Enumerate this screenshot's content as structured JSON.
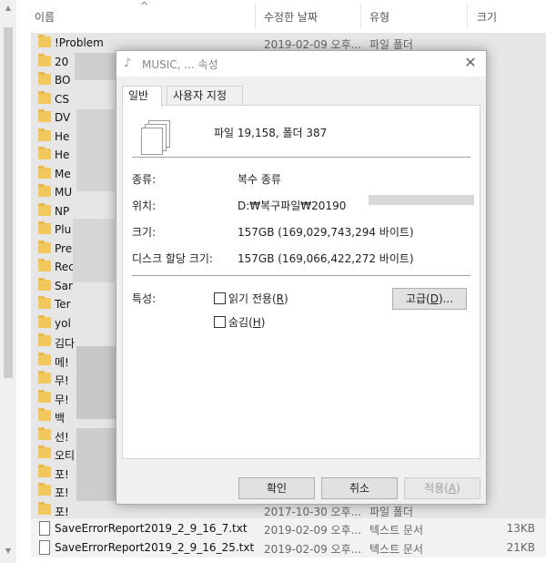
{
  "explorer": {
    "columns": {
      "name": "이름",
      "modified": "수정한 날짜",
      "type": "유형",
      "size": "크기"
    },
    "rows": [
      {
        "name": "!Problem",
        "date": "2019-02-09 오후...",
        "type": "파일 폴더",
        "size": ""
      },
      {
        "name": "20",
        "date": "",
        "type": "",
        "size": ""
      },
      {
        "name": "BO",
        "date": "",
        "type": "",
        "size": ""
      },
      {
        "name": "CS",
        "date": "",
        "type": "",
        "size": ""
      },
      {
        "name": "DV",
        "date": "",
        "type": "",
        "size": ""
      },
      {
        "name": "He",
        "date": "",
        "type": "",
        "size": ""
      },
      {
        "name": "He",
        "date": "",
        "type": "",
        "size": ""
      },
      {
        "name": "Me",
        "date": "",
        "type": "",
        "size": ""
      },
      {
        "name": "MU",
        "date": "",
        "type": "",
        "size": ""
      },
      {
        "name": "NP",
        "date": "",
        "type": "",
        "size": ""
      },
      {
        "name": "Plu",
        "date": "",
        "type": "",
        "size": ""
      },
      {
        "name": "Pre",
        "date": "",
        "type": "",
        "size": ""
      },
      {
        "name": "Rec",
        "date": "",
        "type": "",
        "size": ""
      },
      {
        "name": "Sar",
        "date": "",
        "type": "",
        "size": ""
      },
      {
        "name": "Ter",
        "date": "",
        "type": "",
        "size": ""
      },
      {
        "name": "yol",
        "date": "",
        "type": "",
        "size": ""
      },
      {
        "name": "김다",
        "date": "",
        "type": "",
        "size": ""
      },
      {
        "name": "메!",
        "date": "",
        "type": "",
        "size": ""
      },
      {
        "name": "무!",
        "date": "",
        "type": "",
        "size": ""
      },
      {
        "name": "무!",
        "date": "",
        "type": "",
        "size": ""
      },
      {
        "name": "백",
        "date": "",
        "type": "",
        "size": ""
      },
      {
        "name": "선!",
        "date": "",
        "type": "",
        "size": ""
      },
      {
        "name": "오티",
        "date": "",
        "type": "",
        "size": ""
      },
      {
        "name": "포!",
        "date": "",
        "type": "",
        "size": ""
      },
      {
        "name": "포!",
        "date": "",
        "type": "",
        "size": ""
      },
      {
        "name": "포!",
        "date": "2017-10-30 오후...",
        "type": "파일 폴더",
        "size": ""
      },
      {
        "name": "SaveErrorReport2019_2_9_16_7.txt",
        "date": "2019-02-09 오후...",
        "type": "텍스트 문서",
        "size": "13KB"
      },
      {
        "name": "SaveErrorReport2019_2_9_16_25.txt",
        "date": "2019-02-09 오후...",
        "type": "텍스트 문서",
        "size": "21KB"
      }
    ]
  },
  "dialog": {
    "title": "MUSIC, ... 속성",
    "close_glyph": "✕",
    "tabs": [
      "일반",
      "사용자 지정"
    ],
    "summary": "파일 19,158, 폴더 387",
    "type_label": "종류:",
    "type_value": "복수 종류",
    "location_label": "위치:",
    "location_value": "D:₩복구파일₩20190",
    "size_label": "크기:",
    "size_value": "157GB (169,029,743,294 바이트)",
    "disk_label": "디스크 할당 크기:",
    "disk_value": "157GB (169,066,422,272 바이트)",
    "attr_label": "특성:",
    "readonly_label": "읽기 전용(",
    "readonly_key": "R",
    "hidden_label": "숨김(",
    "hidden_key": "H",
    "advanced_label": "고급(",
    "advanced_key": "D",
    "advanced_suffix": ")...",
    "ok_label": "확인",
    "cancel_label": "취소",
    "apply_label": "적용(",
    "apply_key": "A",
    "close_paren": ")"
  },
  "icons": {
    "folder": "folder-icon",
    "text_file": "text-file-icon",
    "dialog_title": "music-folder-icon",
    "multi_file": "multiple-files-icon"
  },
  "colors": {
    "folder": "#f3c85a",
    "row_bg": "#e6e6e6",
    "dialog_bg": "#f0f0f0"
  }
}
